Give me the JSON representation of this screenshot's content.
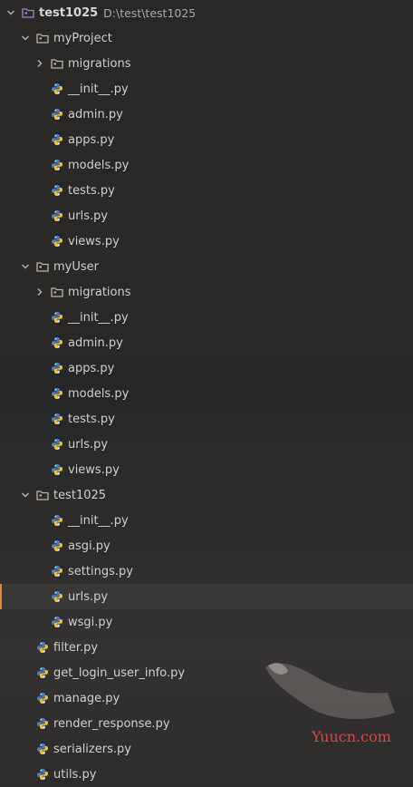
{
  "colors": {
    "folder_outline": "#b9b4ad",
    "root_folder": "#9b87c9",
    "python_blue": "#4a7fb8",
    "python_yellow": "#e8c14a",
    "selection_accent": "#e0892f",
    "watermark": "#e2433f"
  },
  "tree": [
    {
      "label": "test1025",
      "path": "D:\\test\\test1025",
      "type": "root",
      "icon": "root-folder-icon",
      "level": 0,
      "expanded": true
    },
    {
      "label": "myProject",
      "type": "folder",
      "icon": "folder-icon",
      "level": 1,
      "expanded": true
    },
    {
      "label": "migrations",
      "type": "folder",
      "icon": "folder-icon",
      "level": 2,
      "expanded": false
    },
    {
      "label": "__init__.py",
      "type": "file",
      "icon": "python-file-icon",
      "level": 2
    },
    {
      "label": "admin.py",
      "type": "file",
      "icon": "python-file-icon",
      "level": 2
    },
    {
      "label": "apps.py",
      "type": "file",
      "icon": "python-file-icon",
      "level": 2
    },
    {
      "label": "models.py",
      "type": "file",
      "icon": "python-file-icon",
      "level": 2
    },
    {
      "label": "tests.py",
      "type": "file",
      "icon": "python-file-icon",
      "level": 2
    },
    {
      "label": "urls.py",
      "type": "file",
      "icon": "python-file-icon",
      "level": 2
    },
    {
      "label": "views.py",
      "type": "file",
      "icon": "python-file-icon",
      "level": 2
    },
    {
      "label": "myUser",
      "type": "folder",
      "icon": "folder-icon",
      "level": 1,
      "expanded": true
    },
    {
      "label": "migrations",
      "type": "folder",
      "icon": "folder-icon",
      "level": 2,
      "expanded": false
    },
    {
      "label": "__init__.py",
      "type": "file",
      "icon": "python-file-icon",
      "level": 2
    },
    {
      "label": "admin.py",
      "type": "file",
      "icon": "python-file-icon",
      "level": 2
    },
    {
      "label": "apps.py",
      "type": "file",
      "icon": "python-file-icon",
      "level": 2
    },
    {
      "label": "models.py",
      "type": "file",
      "icon": "python-file-icon",
      "level": 2
    },
    {
      "label": "tests.py",
      "type": "file",
      "icon": "python-file-icon",
      "level": 2
    },
    {
      "label": "urls.py",
      "type": "file",
      "icon": "python-file-icon",
      "level": 2
    },
    {
      "label": "views.py",
      "type": "file",
      "icon": "python-file-icon",
      "level": 2
    },
    {
      "label": "test1025",
      "type": "folder",
      "icon": "folder-icon",
      "level": 1,
      "expanded": true
    },
    {
      "label": "__init__.py",
      "type": "file",
      "icon": "python-file-icon",
      "level": 2
    },
    {
      "label": "asgi.py",
      "type": "file",
      "icon": "python-file-icon",
      "level": 2
    },
    {
      "label": "settings.py",
      "type": "file",
      "icon": "python-file-icon",
      "level": 2
    },
    {
      "label": "urls.py",
      "type": "file",
      "icon": "python-file-icon",
      "level": 2,
      "selected": true
    },
    {
      "label": "wsgi.py",
      "type": "file",
      "icon": "python-file-icon",
      "level": 2
    },
    {
      "label": "filter.py",
      "type": "file",
      "icon": "python-file-icon",
      "level": 1
    },
    {
      "label": "get_login_user_info.py",
      "type": "file",
      "icon": "python-file-icon",
      "level": 1
    },
    {
      "label": "manage.py",
      "type": "file",
      "icon": "python-file-icon",
      "level": 1
    },
    {
      "label": "render_response.py",
      "type": "file",
      "icon": "python-file-icon",
      "level": 1
    },
    {
      "label": "serializers.py",
      "type": "file",
      "icon": "python-file-icon",
      "level": 1
    },
    {
      "label": "utils.py",
      "type": "file",
      "icon": "python-file-icon",
      "level": 1
    }
  ],
  "watermark": "Yuucn.com"
}
